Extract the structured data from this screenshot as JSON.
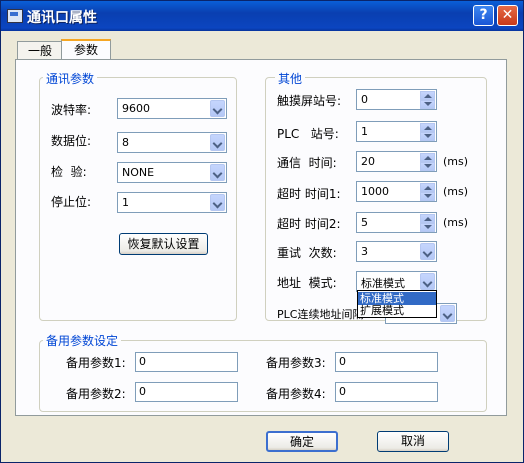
{
  "window": {
    "title": "通讯口属性",
    "help_label": "?",
    "close_label": "✕"
  },
  "tabs": [
    {
      "label": "一般"
    },
    {
      "label": "参数"
    }
  ],
  "comm": {
    "group_label": "通讯参数",
    "baud": {
      "label": "波特率:",
      "value": "9600"
    },
    "data_bits": {
      "label": "数据位:",
      "value": "8"
    },
    "parity": {
      "label": "检  验:",
      "value": "NONE"
    },
    "stop_bits": {
      "label": "停止位:",
      "value": "1"
    },
    "restore_label": "恢复默认设置"
  },
  "other": {
    "group_label": "其他",
    "hmi_station": {
      "label": "触摸屏站号:",
      "value": "0"
    },
    "plc_station": {
      "label": "PLC   站号:",
      "value": "1"
    },
    "comm_time": {
      "label": "通信  时间:",
      "value": "20",
      "unit": "(ms)"
    },
    "timeout1": {
      "label": "超时 时间1:",
      "value": "1000",
      "unit": "(ms)"
    },
    "timeout2": {
      "label": "超时 时间2:",
      "value": "5",
      "unit": "(ms)"
    },
    "retry": {
      "label": "重试  次数:",
      "value": "3"
    },
    "addr_mode": {
      "label": "地址  模式:",
      "value": "标准模式",
      "options": [
        "标准模式",
        "扩展模式"
      ]
    },
    "plc_continuous_label": "PLC连续地址间隔"
  },
  "backup": {
    "group_label": "备用参数设定",
    "p1": {
      "label": "备用参数1:",
      "value": "0"
    },
    "p2": {
      "label": "备用参数2:",
      "value": "0"
    },
    "p3": {
      "label": "备用参数3:",
      "value": "0"
    },
    "p4": {
      "label": "备用参数4:",
      "value": "0"
    }
  },
  "footer": {
    "ok_label": "确定",
    "cancel_label": "取消"
  }
}
